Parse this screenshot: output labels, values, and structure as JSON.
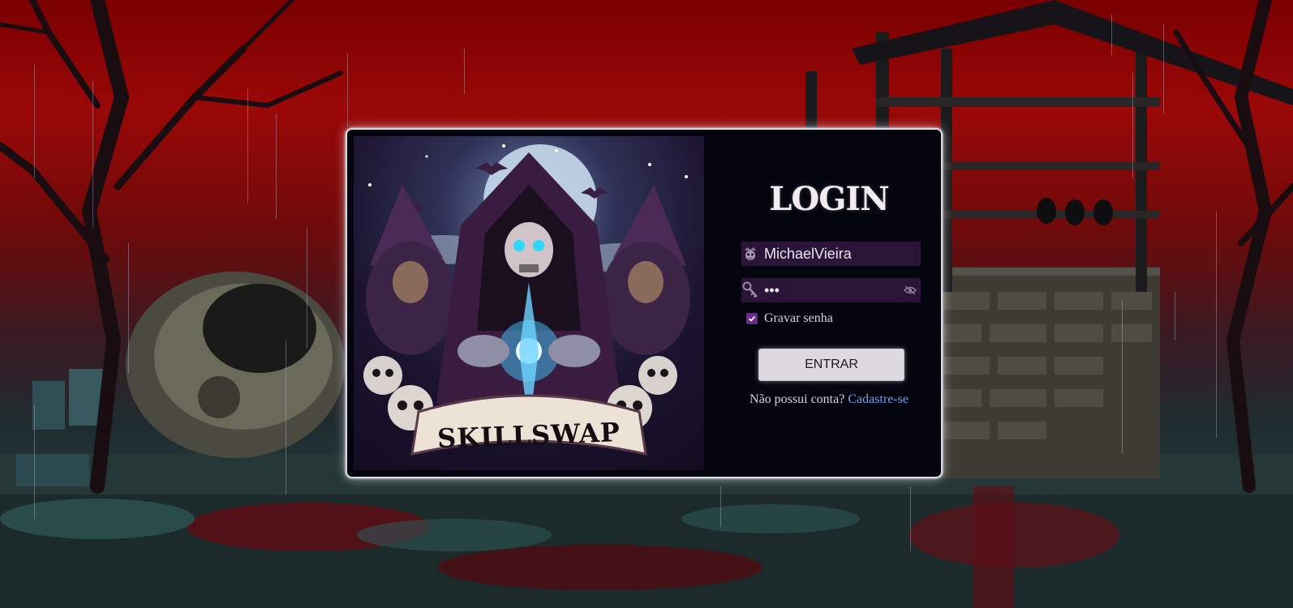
{
  "login": {
    "title": "LOGIN",
    "username_value": "MichaelVieira",
    "password_masked": "•••",
    "remember_label": "Gravar senha",
    "remember_checked": true,
    "submit_label": "ENTRAR",
    "signup_prompt": "Não possui conta?",
    "signup_link": "Cadastre-se"
  },
  "art": {
    "logo_text": "SKILLSWAP"
  },
  "icons": {
    "username": "crown-skull-icon",
    "password": "key-icon",
    "toggle_password": "eye-slash-icon",
    "remember": "check-icon"
  },
  "colors": {
    "accent": "#6fa2e8",
    "field_bg": "#2a1438",
    "card_bg": "#05050f",
    "button_bg": "#dcdae0"
  }
}
